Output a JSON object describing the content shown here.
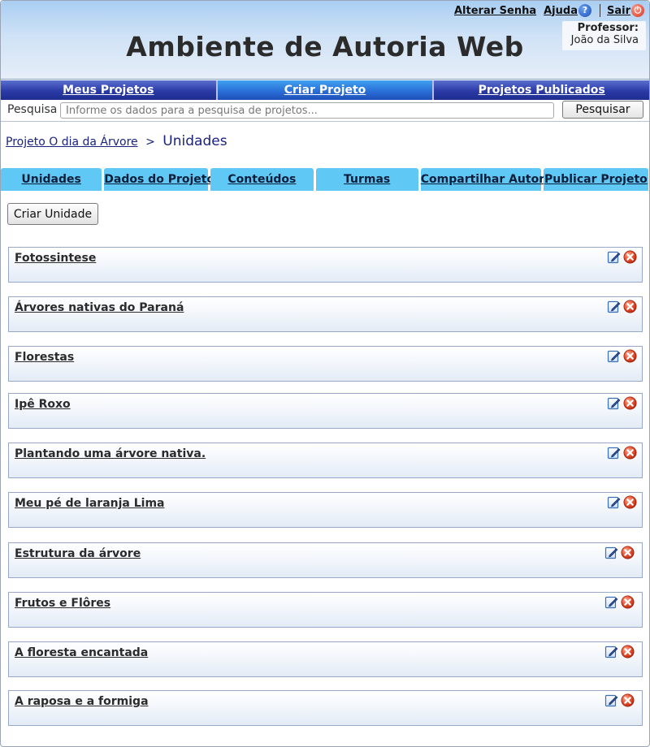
{
  "app": {
    "title": "Ambiente de Autoria Web"
  },
  "header": {
    "links": {
      "change_password": "Alterar Senha",
      "help": "Ajuda",
      "logout": "Sair"
    },
    "professor_label": "Professor:",
    "professor_name": "João da Silva"
  },
  "mainnav": {
    "items": [
      {
        "label": "Meus Projetos"
      },
      {
        "label": "Criar Projeto"
      },
      {
        "label": "Projetos Publicados"
      }
    ],
    "active_index": 1
  },
  "search": {
    "label": "Pesquisa",
    "placeholder": "Informe os dados para a pesquisa de projetos...",
    "value": "",
    "button": "Pesquisar"
  },
  "breadcrumb": {
    "project_link": "Projeto O dia da Árvore",
    "separator": ">",
    "current": "Unidades"
  },
  "subtabs": [
    {
      "label": "Unidades"
    },
    {
      "label": "Dados do Projeto"
    },
    {
      "label": "Conteúdos"
    },
    {
      "label": "Turmas"
    },
    {
      "label": "Compartilhar Autoria"
    },
    {
      "label": "Publicar Projeto"
    }
  ],
  "actions": {
    "create_unit": "Criar Unidade"
  },
  "units": [
    {
      "title": "Fotossintese"
    },
    {
      "title": "Árvores nativas do Paraná"
    },
    {
      "title": "Florestas"
    },
    {
      "title": "Ipê Roxo"
    },
    {
      "title": "Plantando uma árvore nativa."
    },
    {
      "title": "Meu pé de laranja Lima"
    },
    {
      "title": "Estrutura da árvore"
    },
    {
      "title": "Frutos e Flôres"
    },
    {
      "title": "A floresta encantada"
    },
    {
      "title": "A raposa e a formiga"
    }
  ],
  "icons": {
    "help": "help-icon",
    "logout": "power-icon",
    "edit": "edit-icon",
    "delete": "delete-icon"
  },
  "colors": {
    "header_gradient_top": "#a9cef2",
    "nav_bar": "#2a3aa6",
    "nav_active": "#2a6fd8",
    "subtab": "#5fc8f5",
    "delete_red": "#d8321e"
  }
}
